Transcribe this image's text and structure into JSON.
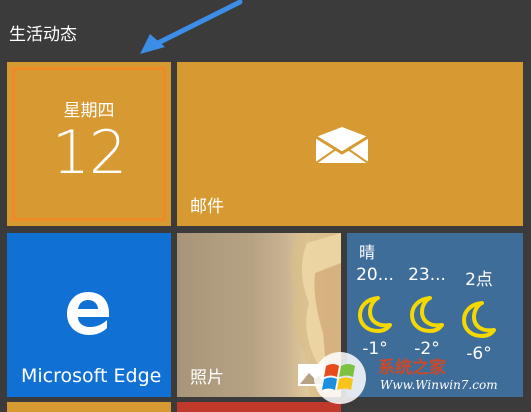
{
  "group": {
    "title": "生活动态"
  },
  "calendar": {
    "day_name": "星期四",
    "date": "12"
  },
  "mail": {
    "label": "邮件"
  },
  "edge": {
    "label": "Microsoft Edge"
  },
  "photos": {
    "label": "照片"
  },
  "weather": {
    "condition": "晴",
    "columns": [
      {
        "label": "20...",
        "icon": "moon-icon",
        "temp": "-1°"
      },
      {
        "label": "23...",
        "icon": "moon-icon",
        "temp": "-2°"
      },
      {
        "label": "2点",
        "icon": "moon-icon",
        "temp": "-6°"
      }
    ]
  },
  "watermark": {
    "cn": "系统之家",
    "url": "Www.Winwin7.com"
  },
  "colors": {
    "background": "#3b3b3b",
    "orange_tile": "#d79a32",
    "edge_blue": "#1170d3",
    "weather_blue": "#3f6d9a",
    "highlight": "#f08a24",
    "arrow": "#3a8ee6"
  }
}
